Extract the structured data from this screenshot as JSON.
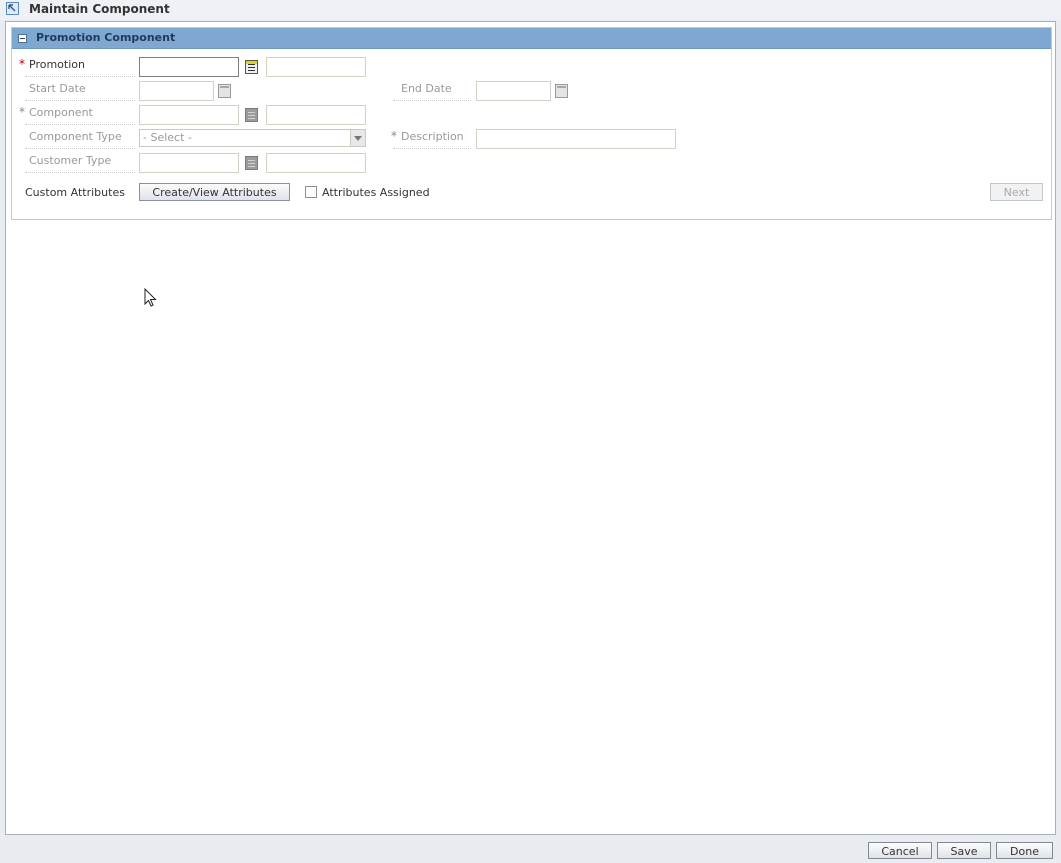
{
  "window": {
    "title": "Maintain Component"
  },
  "panel": {
    "title": "Promotion Component"
  },
  "form": {
    "promotion": {
      "label": "Promotion",
      "required_mark": "*",
      "code_value": "",
      "desc_value": ""
    },
    "start_date": {
      "label": "Start Date",
      "value": ""
    },
    "end_date": {
      "label": "End Date",
      "value": ""
    },
    "component": {
      "label": "Component",
      "required_mark": "*",
      "code_value": "",
      "desc_value": ""
    },
    "component_type": {
      "label": "Component Type",
      "selected": "- Select -"
    },
    "description": {
      "label": "Description",
      "required_mark": "*",
      "value": ""
    },
    "customer_type": {
      "label": "Customer Type",
      "code_value": "",
      "desc_value": ""
    },
    "custom_attributes": {
      "label": "Custom Attributes",
      "button_label": "Create/View Attributes",
      "assigned_label": "Attributes Assigned",
      "assigned_checked": false
    },
    "next_label": "Next"
  },
  "footer": {
    "cancel_label": "Cancel",
    "save_label": "Save",
    "done_label": "Done"
  },
  "icons": {
    "window_icon": "arrow-up-left-icon",
    "collapse": "collapse-minus-icon",
    "calendar": "calendar-icon",
    "lov": "list-of-values-icon",
    "cursor": "mouse-pointer-icon"
  },
  "colors": {
    "panel_header": "#7fa8d1",
    "required_active": "#b30000"
  }
}
